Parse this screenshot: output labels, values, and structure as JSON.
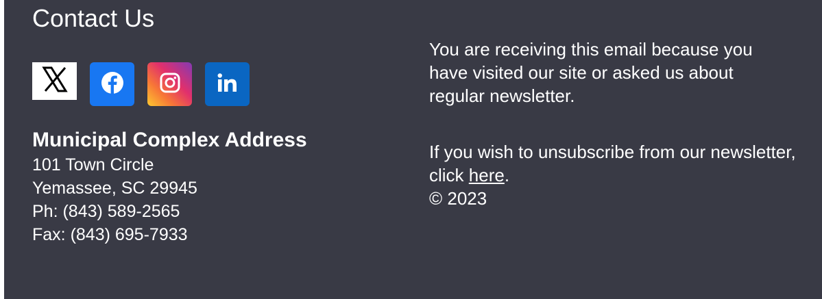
{
  "contact": {
    "title": "Contact Us",
    "social": [
      {
        "name": "X",
        "icon": "x-icon"
      },
      {
        "name": "Facebook",
        "icon": "facebook-icon"
      },
      {
        "name": "Instagram",
        "icon": "instagram-icon"
      },
      {
        "name": "LinkedIn",
        "icon": "linkedin-icon"
      }
    ],
    "address_heading": "Municipal Complex Address",
    "address_lines": [
      "101 Town Circle",
      "Yemassee, SC 29945",
      "Ph: (843) 589-2565",
      "Fax: (843) 695-7933"
    ]
  },
  "notice": {
    "receiving_text": "You are receiving this email because you have visited our site or asked us about regular newsletter.",
    "unsubscribe_prefix": "If you wish to unsubscribe from our newsletter, click ",
    "unsubscribe_link": "here",
    "unsubscribe_suffix": ".",
    "copyright": "© 2023"
  },
  "colors": {
    "background": "#393a45",
    "facebook": "#1877f2",
    "linkedin": "#0a66c2"
  }
}
